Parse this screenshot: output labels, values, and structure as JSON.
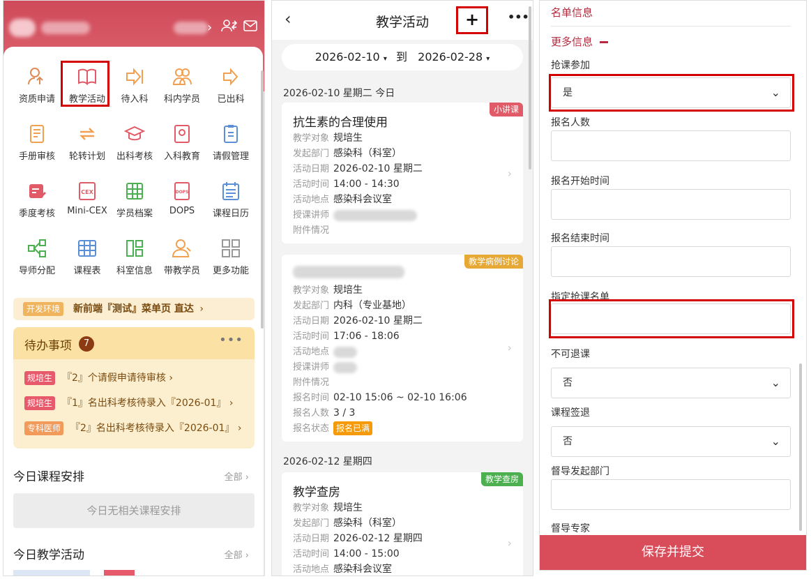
{
  "home": {
    "grid": [
      {
        "label": "资质申请",
        "icon": "qualification-icon"
      },
      {
        "label": "教学活动",
        "icon": "book-icon"
      },
      {
        "label": "待入科",
        "icon": "enter-arrow-icon"
      },
      {
        "label": "科内学员",
        "icon": "students-icon"
      },
      {
        "label": "已出科",
        "icon": "exit-arrow-icon"
      },
      {
        "label": "手册审核",
        "icon": "handbook-icon"
      },
      {
        "label": "轮转计划",
        "icon": "rotation-icon"
      },
      {
        "label": "出科考核",
        "icon": "graduation-cap-icon"
      },
      {
        "label": "入科教育",
        "icon": "education-icon"
      },
      {
        "label": "请假管理",
        "icon": "leave-icon"
      },
      {
        "label": "季度考核",
        "icon": "quarter-exam-icon"
      },
      {
        "label": "Mini-CEX",
        "icon": "cex-icon"
      },
      {
        "label": "学员档案",
        "icon": "archive-icon"
      },
      {
        "label": "DOPS",
        "icon": "dops-icon"
      },
      {
        "label": "课程日历",
        "icon": "calendar-icon"
      },
      {
        "label": "导师分配",
        "icon": "share-icon"
      },
      {
        "label": "课程表",
        "icon": "timetable-icon"
      },
      {
        "label": "科室信息",
        "icon": "dept-info-icon"
      },
      {
        "label": "带教学员",
        "icon": "teaching-students-icon"
      },
      {
        "label": "更多功能",
        "icon": "more-grid-icon"
      }
    ],
    "dev_tag": "开发环境",
    "dev_text": "新前端『测试』菜单页 直达",
    "todo_title": "待办事项",
    "todo_count": "7",
    "todo_items": [
      {
        "tag": "规培生",
        "text": "『2』个请假申请待审核"
      },
      {
        "tag": "规培生",
        "text": "『1』名出科考核待录入『2026-01』"
      },
      {
        "tag": "专科医师",
        "text": "『2』名出科考核待录入『2026-01』"
      }
    ],
    "today_course_title": "今日课程安排",
    "today_course_empty": "今日无相关课程安排",
    "today_activity_title": "今日教学活动",
    "all_label": "全部"
  },
  "activities": {
    "title": "教学活动",
    "date_from": "2026-02-10",
    "date_to": "2026-02-28",
    "date_sep": "到",
    "days": [
      {
        "heading": "2026-02-10 星期二 今日"
      },
      {
        "heading": "2026-02-12 星期四"
      }
    ],
    "field_labels": {
      "target": "教学对象",
      "dept": "发起部门",
      "date": "活动日期",
      "time": "活动时间",
      "place": "活动地点",
      "teacher": "授课讲师",
      "attach": "附件情况",
      "signup_time": "报名时间",
      "signup_count": "报名人数",
      "signup_status": "报名状态"
    },
    "cards": [
      {
        "type": "小讲课",
        "type_color": "#e05b67",
        "name": "抗生素的合理使用",
        "target": "规培生",
        "dept": "感染科（科室）",
        "date": "2026-02-10 星期二",
        "time": "14:00 - 14:30",
        "place": "感染科会议室"
      },
      {
        "type": "教学病例讨论",
        "type_color": "#e6a935",
        "target": "规培生",
        "dept": "内科（专业基地）",
        "date": "2026-02-10 星期二",
        "time": "17:06 - 18:06",
        "signup_time": "02-10 15:06 ~ 02-10 16:06",
        "signup_count": "3 / 3",
        "signup_status": "报名已满"
      },
      {
        "type": "教学查房",
        "type_color": "#4caf50",
        "name": "教学查房",
        "target": "规培生",
        "dept": "感染科（科室）",
        "date": "2026-02-12 星期四",
        "time": "14:00 - 15:00",
        "place": "感染科会议室"
      }
    ]
  },
  "form": {
    "section_list": "名单信息",
    "section_more": "更多信息",
    "fields": [
      {
        "label": "抢课参加",
        "value": "是",
        "kind": "select"
      },
      {
        "label": "报名人数",
        "value": "",
        "kind": "input"
      },
      {
        "label": "报名开始时间",
        "value": "",
        "kind": "input"
      },
      {
        "label": "报名结束时间",
        "value": "",
        "kind": "input"
      },
      {
        "label": "指定抢课名单",
        "value": "",
        "kind": "input"
      },
      {
        "label": "不可退课",
        "value": "否",
        "kind": "select"
      },
      {
        "label": "课程签退",
        "value": "否",
        "kind": "select"
      },
      {
        "label": "督导发起部门",
        "value": "",
        "kind": "input"
      },
      {
        "label": "督导专家",
        "value": "",
        "kind": "input"
      }
    ],
    "submit_label": "保存并提交"
  },
  "colors": {
    "accent": "#d94c5a",
    "highlight": "#d40000"
  }
}
